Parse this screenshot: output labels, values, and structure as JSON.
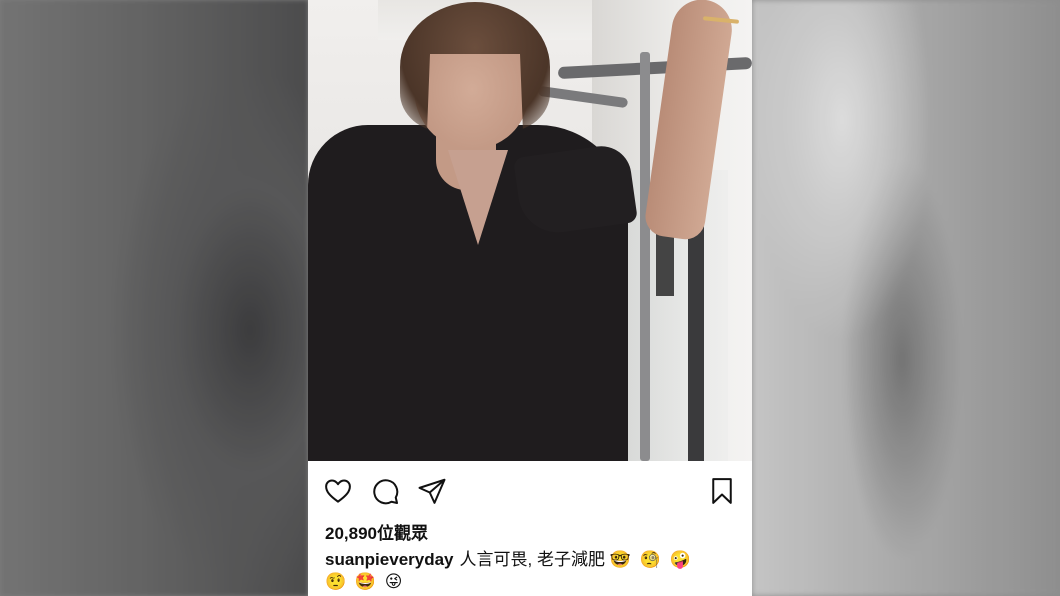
{
  "post": {
    "views_text": "20,890位觀眾",
    "username": "suanpieveryday",
    "caption_text": "人言可畏, 老子減肥",
    "caption_emojis": "🤓 🧐 🤪",
    "caption_emojis_line2": "🤨 🤩 😜"
  },
  "icons": {
    "like": "heart-icon",
    "comment": "comment-bubble-icon",
    "share": "paper-plane-icon",
    "save": "bookmark-icon"
  },
  "colors": {
    "icon_stroke": "#111111",
    "text": "#111111",
    "background": "#ffffff"
  }
}
